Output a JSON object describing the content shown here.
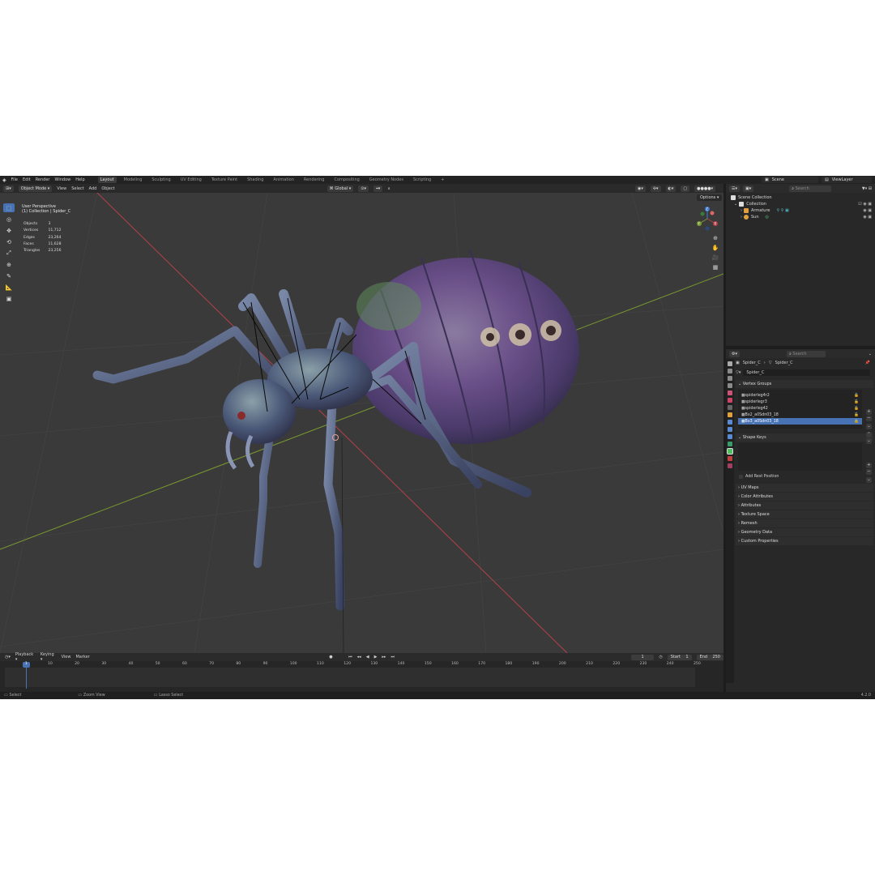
{
  "menu": [
    "File",
    "Edit",
    "Render",
    "Window",
    "Help"
  ],
  "workspaces": [
    {
      "label": "Layout",
      "active": true
    },
    {
      "label": "Modeling"
    },
    {
      "label": "Sculpting"
    },
    {
      "label": "UV Editing"
    },
    {
      "label": "Texture Paint"
    },
    {
      "label": "Shading"
    },
    {
      "label": "Animation"
    },
    {
      "label": "Rendering"
    },
    {
      "label": "Compositing"
    },
    {
      "label": "Geometry Nodes"
    },
    {
      "label": "Scripting"
    }
  ],
  "add_tab_label": "+",
  "scene": {
    "name": "Scene",
    "view_layer": "ViewLayer"
  },
  "viewport_header": {
    "mode": "Object Mode",
    "menus": [
      "View",
      "Select",
      "Add",
      "Object"
    ],
    "transform_orientation": "Global",
    "options_label": "Options"
  },
  "overlay": {
    "view_name": "User Perspective",
    "collection_path": "(1) Collection | Spider_C"
  },
  "stats": [
    {
      "label": "Objects",
      "value": "3"
    },
    {
      "label": "Vertices",
      "value": "11,712"
    },
    {
      "label": "Edges",
      "value": "23,264"
    },
    {
      "label": "Faces",
      "value": "11,628"
    },
    {
      "label": "Triangles",
      "value": "23,256"
    }
  ],
  "gizmo_axes": {
    "x": "X",
    "y": "Y",
    "z": "Z"
  },
  "timeline": {
    "menus": [
      "Playback",
      "Keying",
      "View",
      "Marker"
    ],
    "current_frame": "1",
    "start_label": "Start",
    "start": "1",
    "end_label": "End",
    "end": "250",
    "ruler": [
      "1",
      "10",
      "20",
      "30",
      "40",
      "50",
      "60",
      "70",
      "80",
      "90",
      "100",
      "110",
      "120",
      "130",
      "140",
      "150",
      "160",
      "170",
      "180",
      "190",
      "200",
      "210",
      "220",
      "230",
      "240",
      "250"
    ]
  },
  "statusbar": {
    "select": "Select",
    "zoom": "Zoom View",
    "lasso": "Lasso Select",
    "version": "4.2.0"
  },
  "outliner": {
    "search_placeholder": "Search",
    "items": [
      {
        "label": "Scene Collection",
        "indent": 0
      },
      {
        "label": "Collection",
        "indent": 1
      },
      {
        "label": "Armature",
        "indent": 2
      },
      {
        "label": "Sun",
        "indent": 2
      }
    ]
  },
  "properties": {
    "search_placeholder": "Search",
    "breadcrumb_object": "Spider_C",
    "breadcrumb_data": "Spider_C",
    "mesh_name": "Spider_C",
    "vertex_groups_label": "Vertex Groups",
    "vertex_groups": [
      "spiderleg4r2",
      "spiderlegr3",
      "spiderleg42",
      "Bx2_a0Sdn03_18",
      "Bx3_a0Sdn03_18"
    ],
    "selected_vertex_group": 4,
    "shape_keys_label": "Shape Keys",
    "add_rest_position": "Add Rest Position",
    "panels": [
      "UV Maps",
      "Color Attributes",
      "Attributes",
      "Texture Space",
      "Remesh",
      "Geometry Data",
      "Custom Properties"
    ]
  },
  "colors": {
    "accent": "#4772b3",
    "viewport_bg": "#3a3a3a",
    "x_axis": "#b5414a",
    "y_axis": "#7a9a2f",
    "z_axis": "#3f79d0"
  }
}
